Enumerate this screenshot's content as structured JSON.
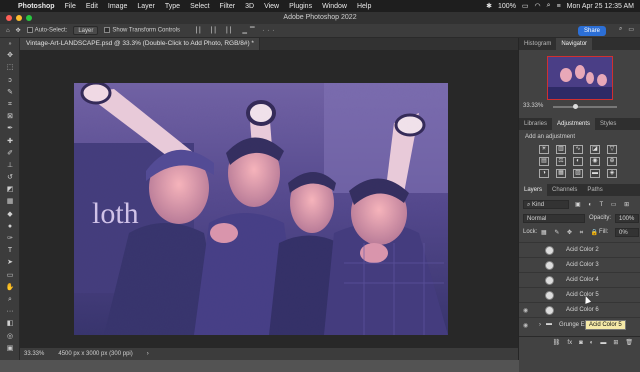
{
  "menubar": {
    "app_name": "Photoshop",
    "items": [
      "File",
      "Edit",
      "Image",
      "Layer",
      "Type",
      "Select",
      "Filter",
      "3D",
      "View",
      "Plugins",
      "Window",
      "Help"
    ],
    "battery": "100%",
    "datetime": "Mon Apr 25  12:35 AM"
  },
  "window": {
    "title": "Adobe Photoshop 2022"
  },
  "options": {
    "auto_select_label": "Auto-Select:",
    "auto_select_value": "Layer",
    "transform_label": "Show Transform Controls",
    "share_label": "Share"
  },
  "document": {
    "tab_title": "Vintage-Art-LANDSCAPE.psd @ 33.3% (Double-Click to Add Photo, RGB/8#) *",
    "zoom": "33.33%",
    "dimensions": "4500 px x 3000 px (300 ppi)"
  },
  "navigator": {
    "tabs": [
      "Histogram",
      "Navigator"
    ],
    "active_tab": "Navigator",
    "zoom": "33.33%"
  },
  "adjustments": {
    "tabs": [
      "Libraries",
      "Adjustments",
      "Styles"
    ],
    "hint": "Add an adjustment"
  },
  "layers": {
    "tabs": [
      "Layers",
      "Channels",
      "Paths"
    ],
    "filter_label": "Kind",
    "blend_mode": "Normal",
    "opacity_label": "Opacity:",
    "opacity_value": "100%",
    "lock_label": "Lock:",
    "fill_label": "Fill:",
    "fill_value": "0%",
    "items": [
      {
        "name": "Acid Color 2"
      },
      {
        "name": "Acid Color 3"
      },
      {
        "name": "Acid Color 4"
      },
      {
        "name": "Acid Color 5"
      },
      {
        "name": "Acid Color 6"
      },
      {
        "name": "Grunge Effect Options"
      }
    ],
    "tooltip": "Acid Color 5"
  },
  "colors": {
    "accent": "#2c6fd6",
    "duotone_dark": "#2a2a6a",
    "duotone_light": "#f0a0a8"
  }
}
